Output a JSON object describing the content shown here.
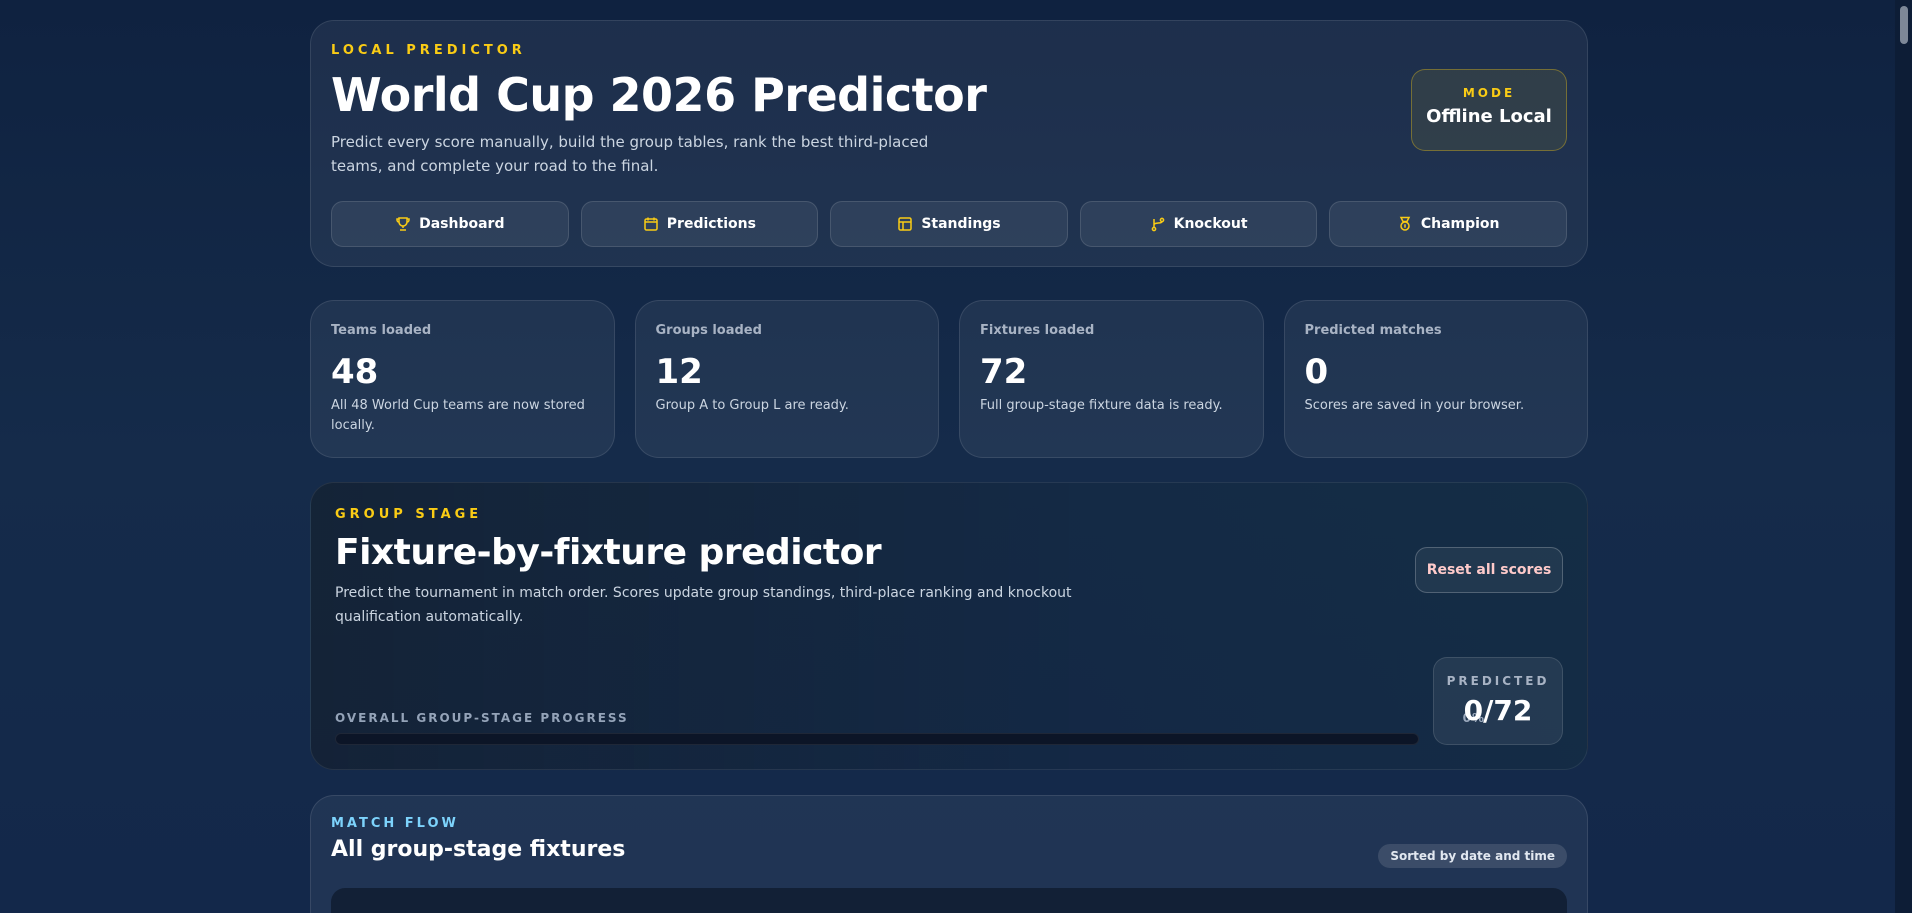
{
  "hero": {
    "eyebrow": "LOCAL PREDICTOR",
    "title": "World Cup 2026 Predictor",
    "description": "Predict every score manually, build the group tables, rank the best third-placed teams, and complete your road to the final.",
    "mode_label": "MODE",
    "mode_value": "Offline Local"
  },
  "nav": [
    {
      "label": "Dashboard",
      "icon": "trophy-icon"
    },
    {
      "label": "Predictions",
      "icon": "calendar-icon"
    },
    {
      "label": "Standings",
      "icon": "table-icon"
    },
    {
      "label": "Knockout",
      "icon": "branch-icon"
    },
    {
      "label": "Champion",
      "icon": "medal-icon"
    }
  ],
  "stats": [
    {
      "label": "Teams loaded",
      "value": "48",
      "desc": "All 48 World Cup teams are now stored locally."
    },
    {
      "label": "Groups loaded",
      "value": "12",
      "desc": "Group A to Group L are ready."
    },
    {
      "label": "Fixtures loaded",
      "value": "72",
      "desc": "Full group-stage fixture data is ready."
    },
    {
      "label": "Predicted matches",
      "value": "0",
      "desc": "Scores are saved in your browser."
    }
  ],
  "group_stage": {
    "eyebrow": "GROUP STAGE",
    "title": "Fixture-by-fixture predictor",
    "description": "Predict the tournament in match order. Scores update group standings, third-place ranking and knockout qualification automatically.",
    "reset_label": "Reset all scores",
    "progress_label": "OVERALL GROUP-STAGE PROGRESS",
    "progress_pct_text": "0%",
    "progress_fraction": 0,
    "predicted_label": "PREDICTED",
    "predicted_value": "0/72"
  },
  "match_flow": {
    "eyebrow": "MATCH FLOW",
    "title": "All group-stage fixtures",
    "sorted_label": "Sorted by date and time"
  },
  "colors": {
    "accent": "#facc15",
    "info": "#7dd3fc",
    "danger_text": "#fecaca"
  }
}
